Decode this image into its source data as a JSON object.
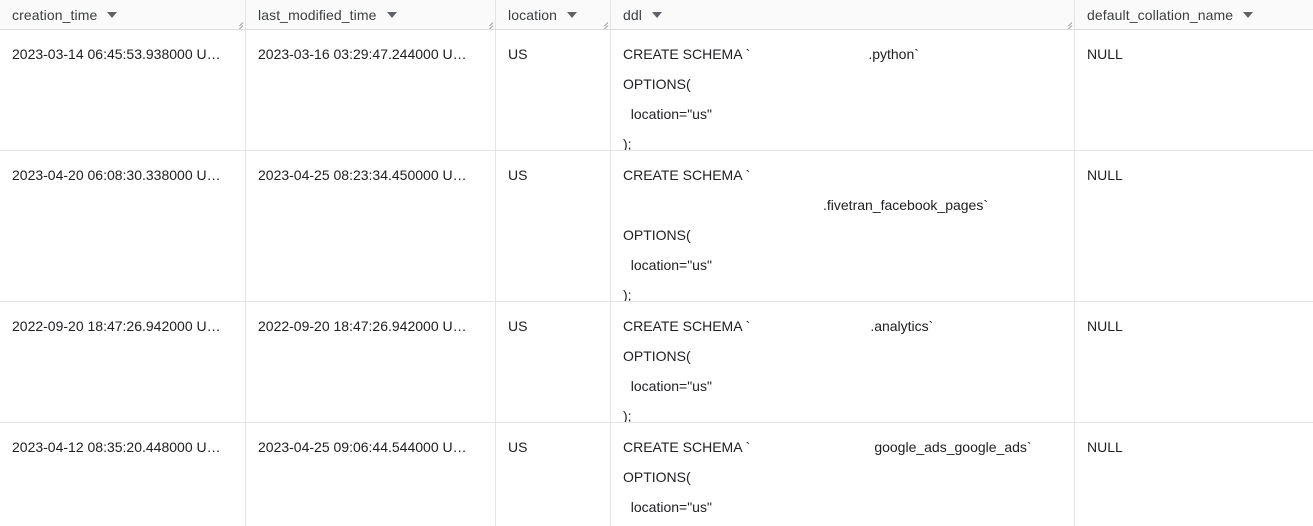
{
  "table": {
    "columns": [
      {
        "key": "creation_time",
        "label": "creation_time",
        "sort_icon": "chevron-down-icon"
      },
      {
        "key": "last_modified_time",
        "label": "last_modified_time",
        "sort_icon": "chevron-down-icon"
      },
      {
        "key": "location",
        "label": "location",
        "sort_icon": "chevron-down-icon"
      },
      {
        "key": "ddl",
        "label": "ddl",
        "sort_icon": "chevron-down-icon"
      },
      {
        "key": "default_collation_name",
        "label": "default_collation_name",
        "sort_icon": "chevron-down-icon"
      }
    ],
    "rows": [
      {
        "creation_time": "2023-03-14 06:45:53.938000 U…",
        "last_modified_time": "2023-03-16 03:29:47.244000 U…",
        "location": "US",
        "ddl": {
          "line1_prefix": "CREATE SCHEMA `",
          "line1_suffix": ".python`",
          "line2": "OPTIONS(",
          "line3": "  location=\"us\"",
          "line4": ");"
        },
        "default_collation_name": "NULL"
      },
      {
        "creation_time": "2023-04-20 06:08:30.338000 U…",
        "last_modified_time": "2023-04-25 08:23:34.450000 U…",
        "location": "US",
        "ddl": {
          "line1_prefix": "CREATE SCHEMA `",
          "line1_suffix": "",
          "line1b_suffix": ".fivetran_facebook_pages`",
          "line2": "OPTIONS(",
          "line3": "  location=\"us\"",
          "line4": ");"
        },
        "default_collation_name": "NULL"
      },
      {
        "creation_time": "2022-09-20 18:47:26.942000 U…",
        "last_modified_time": "2022-09-20 18:47:26.942000 U…",
        "location": "US",
        "ddl": {
          "line1_prefix": "CREATE SCHEMA `",
          "line1_suffix": ".analytics`",
          "line2": "OPTIONS(",
          "line3": "  location=\"us\"",
          "line4": ");"
        },
        "default_collation_name": "NULL"
      },
      {
        "creation_time": "2023-04-12 08:35:20.448000 U…",
        "last_modified_time": "2023-04-25 09:06:44.544000 U…",
        "location": "US",
        "ddl": {
          "line1_prefix": "CREATE SCHEMA `",
          "line1_suffix": "google_ads_google_ads`",
          "line2": "OPTIONS(",
          "line3": "  location=\"us\"",
          "line4": ""
        },
        "default_collation_name": "NULL"
      }
    ]
  },
  "colors": {
    "header_bg": "#fafafa",
    "border": "#e3e4e6",
    "header_border": "#dadce0",
    "text": "#202124",
    "header_text": "#3c4043",
    "icon": "#5f6368"
  }
}
